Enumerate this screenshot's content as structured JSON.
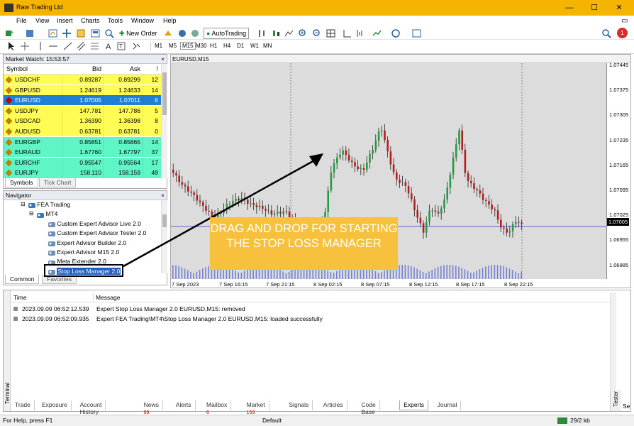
{
  "window": {
    "title": "Raw Trading Ltd",
    "minimize": "—",
    "maximize": "☐",
    "close": "✕"
  },
  "menu": [
    "File",
    "View",
    "Insert",
    "Charts",
    "Tools",
    "Window",
    "Help"
  ],
  "toolbar": {
    "new_order": "New Order",
    "autotrading": "AutoTrading",
    "timeframes": [
      "M1",
      "M5",
      "M15",
      "M30",
      "H1",
      "H4",
      "D1",
      "W1",
      "MN"
    ],
    "notification_count": "1"
  },
  "market_watch": {
    "title": "Market Watch: 15:53:57",
    "columns": {
      "symbol": "Symbol",
      "bid": "Bid",
      "ask": "Ask",
      "spread": "!"
    },
    "rows": [
      {
        "symbol": "USDCHF",
        "bid": "0.89287",
        "ask": "0.89299",
        "spread": "12",
        "bg": "#fffd55",
        "icon": "#c08000"
      },
      {
        "symbol": "GBPUSD",
        "bid": "1.24619",
        "ask": "1.24633",
        "spread": "14",
        "bg": "#fffd55",
        "icon": "#c08000"
      },
      {
        "symbol": "EURUSD",
        "bid": "1.07005",
        "ask": "1.07011",
        "spread": "6",
        "bg": "#1e7fd4",
        "icon": "#c00000",
        "selected": true
      },
      {
        "symbol": "USDJPY",
        "bid": "147.781",
        "ask": "147.786",
        "spread": "5",
        "bg": "#fffd55",
        "icon": "#c08000"
      },
      {
        "symbol": "USDCAD",
        "bid": "1.36390",
        "ask": "1.36398",
        "spread": "8",
        "bg": "#fffd55",
        "icon": "#c08000"
      },
      {
        "symbol": "AUDUSD",
        "bid": "0.63781",
        "ask": "0.63781",
        "spread": "0",
        "bg": "#fffd55",
        "icon": "#c08000"
      },
      {
        "symbol": "EURGBP",
        "bid": "0.85851",
        "ask": "0.85865",
        "spread": "14",
        "bg": "#5ff5c7",
        "icon": "#c08000"
      },
      {
        "symbol": "EURAUD",
        "bid": "1.67760",
        "ask": "1.67797",
        "spread": "37",
        "bg": "#5ff5c7",
        "icon": "#c08000"
      },
      {
        "symbol": "EURCHF",
        "bid": "0.95547",
        "ask": "0.95564",
        "spread": "17",
        "bg": "#5ff5c7",
        "icon": "#c08000"
      },
      {
        "symbol": "EURJPY",
        "bid": "158.110",
        "ask": "158.159",
        "spread": "49",
        "bg": "#5ff5c7",
        "icon": "#c08000"
      }
    ],
    "tabs": [
      "Symbols",
      "Tick Chart"
    ]
  },
  "navigator": {
    "title": "Navigator",
    "items": [
      {
        "label": "FEA Trading",
        "level": 0
      },
      {
        "label": "MT4",
        "level": 1
      },
      {
        "label": "Custom Expert Advisor Live 2.0",
        "level": 2
      },
      {
        "label": "Custom Expert Advisor Tester 2.0",
        "level": 2
      },
      {
        "label": "Expert Advisor Builder 2.0",
        "level": 2
      },
      {
        "label": "Expert Advisor M15 2.0",
        "level": 2
      },
      {
        "label": "Meta Extender 2.0",
        "level": 2
      },
      {
        "label": "Stop Loss Manager 2.0",
        "level": 2,
        "selected": true
      }
    ],
    "tabs": [
      "Common",
      "Favorites"
    ]
  },
  "chart": {
    "title": "EURUSD,M15",
    "current_price": "1.07005",
    "price_labels": [
      "1.07445",
      "1.07375",
      "1.07305",
      "1.07235",
      "1.07165",
      "1.07095",
      "1.07025",
      "1.06955",
      "1.06885"
    ],
    "time_labels": [
      "7 Sep 2023",
      "7 Sep 16:15",
      "7 Sep 21:15",
      "8 Sep 02:15",
      "8 Sep 07:15",
      "8 Sep 12:15",
      "8 Sep 17:15",
      "8 Sep 22:15"
    ],
    "callout": "DRAG AND DROP FOR STARTING THE STOP LOSS MANAGER",
    "callout_color": "#f7c13d"
  },
  "terminal": {
    "side_label": "Terminal",
    "columns": {
      "time": "Time",
      "message": "Message"
    },
    "rows": [
      {
        "time": "2023.09.09 06:52:12.539",
        "message": "Expert Stop Loss Manager 2.0 EURUSD,M15: removed"
      },
      {
        "time": "2023.09.09 06:52:09.935",
        "message": "Expert FEA Trading\\MT4\\Stop Loss Manager 2.0 EURUSD,M15: loaded successfully"
      }
    ],
    "tabs": [
      {
        "label": "Trade",
        "count": ""
      },
      {
        "label": "Exposure",
        "count": ""
      },
      {
        "label": "Account History",
        "count": ""
      },
      {
        "label": "News",
        "count": "99"
      },
      {
        "label": "Alerts",
        "count": ""
      },
      {
        "label": "Mailbox",
        "count": "6"
      },
      {
        "label": "Market",
        "count": "153"
      },
      {
        "label": "Signals",
        "count": ""
      },
      {
        "label": "Articles",
        "count": ""
      },
      {
        "label": "Code Base",
        "count": ""
      },
      {
        "label": "Experts",
        "count": "",
        "active": true
      },
      {
        "label": "Journal",
        "count": ""
      }
    ],
    "tester_label": "Tester",
    "tester_tab": "Se"
  },
  "status": {
    "help": "For Help, press F1",
    "profile": "Default",
    "traffic": "29/2 kb"
  }
}
